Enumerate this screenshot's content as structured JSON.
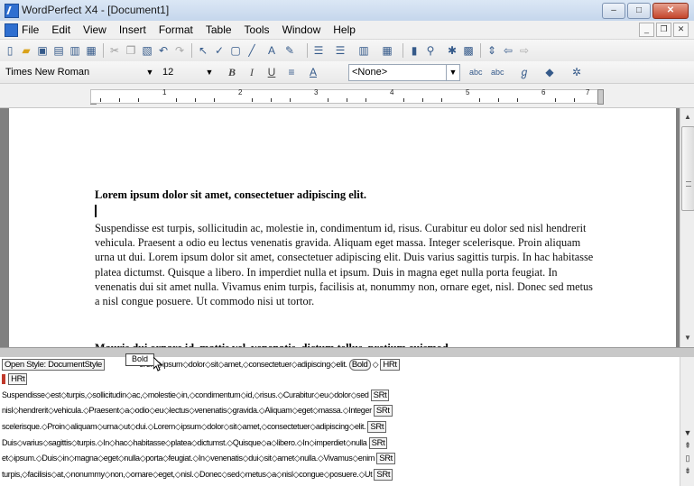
{
  "window": {
    "title": "WordPerfect X4 - [Document1]",
    "controls": {
      "minimize": "–",
      "maximize": "□",
      "close": "✕"
    }
  },
  "menubar": {
    "items": [
      "File",
      "Edit",
      "View",
      "Insert",
      "Format",
      "Table",
      "Tools",
      "Window",
      "Help"
    ],
    "mdi_controls": {
      "minimize": "_",
      "restore": "❐",
      "close": "✕"
    }
  },
  "property_bar": {
    "font_name": "Times New Roman",
    "font_size": "12",
    "style": "<None>",
    "bold": "B",
    "italic": "I",
    "underline": "U"
  },
  "ruler": {
    "numbers": [
      "1",
      "2",
      "3",
      "4",
      "5",
      "6",
      "7"
    ]
  },
  "document": {
    "heading": "Lorem ipsum dolor sit amet, consectetuer adipiscing elit.",
    "paragraph": "Suspendisse est turpis, sollicitudin ac, molestie in, condimentum id, risus. Curabitur eu dolor sed nisl hendrerit vehicula. Praesent a odio eu lectus venenatis gravida. Aliquam eget massa. Integer scelerisque. Proin aliquam urna ut dui. Lorem ipsum dolor sit amet, consectetuer adipiscing elit. Duis varius sagittis turpis. In hac habitasse platea dictumst. Quisque a libero. In imperdiet nulla et ipsum. Duis in magna eget nulla porta feugiat. In venenatis dui sit amet nulla. Vivamus enim turpis, facilisis at, nonummy non, ornare eget, nisl. Donec sed metus a nisl congue posuere. Ut commodo nisi ut tortor.",
    "next_line_partial": "Mauris dui ornare id, mattis vel, venenatis, dictum tellus, pretium euismod."
  },
  "reveal_codes": {
    "popup": "Bold",
    "line1_prefix": "Open Style: DocumentStyle",
    "line1_text": "orem◇ipsum◇dolor◇sit◇amet,◇consectetuer◇adipiscing◇elit.",
    "line1_code_bold": "Bold",
    "line1_sep": "◇",
    "line1_code_hrt": "HRt",
    "line2_code": "HRt",
    "lines": [
      {
        "text": "Suspendisse◇est◇turpis,◇sollicitudin◇ac,◇molestie◇in,◇condimentum◇id,◇risus.◇Curabitur◇eu◇dolor◇sed",
        "code": "SRt"
      },
      {
        "text": "nisl◇hendrerit◇vehicula.◇Praesent◇a◇odio◇eu◇lectus◇venenatis◇gravida.◇Aliquam◇eget◇massa.◇Integer",
        "code": "SRt"
      },
      {
        "text": "scelerisque.◇Proin◇aliquam◇urna◇ut◇dui.◇Lorem◇ipsum◇dolor◇sit◇amet,◇consectetuer◇adipiscing◇elit.",
        "code": "SRt"
      },
      {
        "text": "Duis◇varius◇sagittis◇turpis.◇In◇hac◇habitasse◇platea◇dictumst.◇Quisque◇a◇libero.◇In◇imperdiet◇nulla",
        "code": "SRt"
      },
      {
        "text": "et◇ipsum.◇Duis◇in◇magna◇eget◇nulla◇porta◇feugiat.◇In◇venenatis◇dui◇sit◇amet◇nulla.◇Vivamus◇enim",
        "code": "SRt"
      },
      {
        "text": "turpis,◇facilisis◇at,◇nonummy◇non,◇ornare◇eget,◇nisl.◇Donec◇sed◇metus◇a◇nisl◇congue◇posuere.◇Ut",
        "code": "SRt"
      }
    ]
  }
}
